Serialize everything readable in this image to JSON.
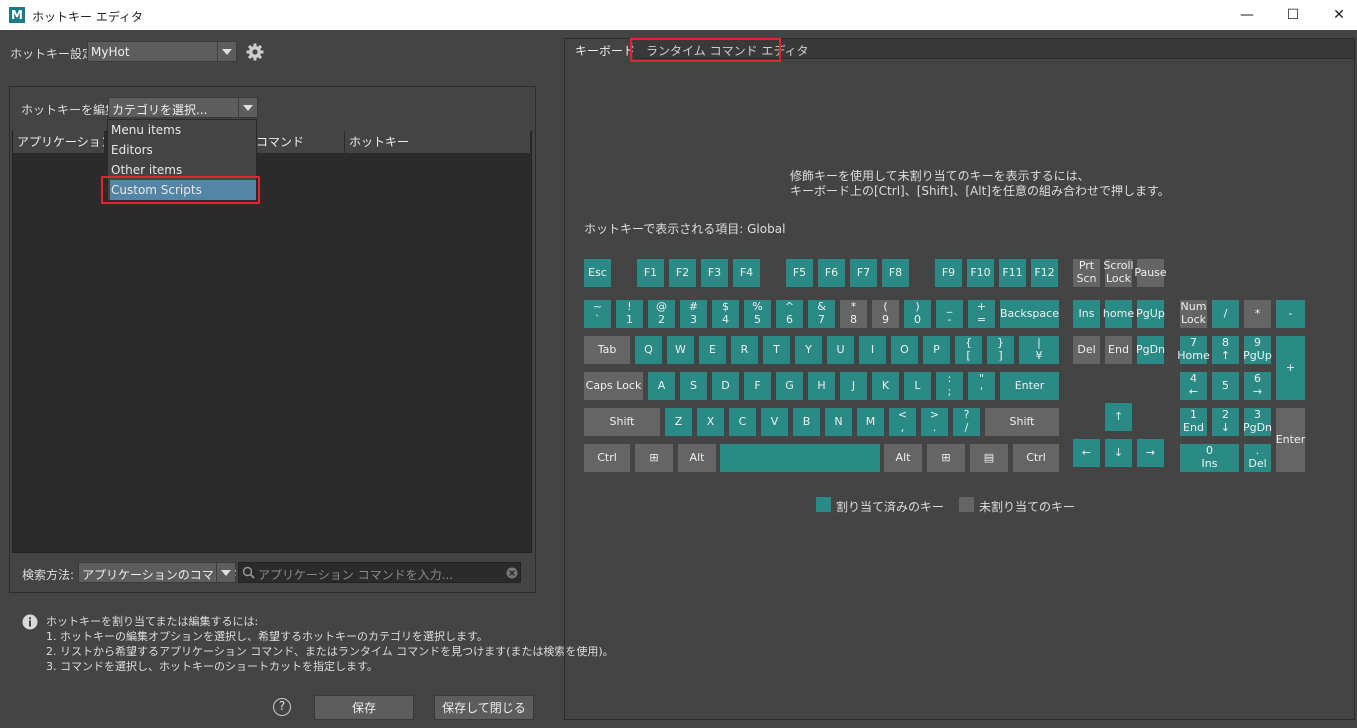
{
  "window": {
    "title": "ホットキー エディタ",
    "logo": "M",
    "minimize": "—",
    "maximize": "☐",
    "close": "✕"
  },
  "left": {
    "hotkey_setting_label": "ホットキー設定:",
    "hotkey_setting_value": "MyHot",
    "edit_label": "ホットキーを編集:",
    "edit_value": "カテゴリを選択...",
    "columns": [
      "アプリケーションのコ",
      "コマンド",
      "ホットキー"
    ],
    "dropdown": [
      "Menu items",
      "Editors",
      "Other items",
      "Custom Scripts"
    ],
    "search_method_label": "検索方法:",
    "search_method_value": "アプリケーションのコマンド",
    "search_placeholder": "アプリケーション コマンドを入力...",
    "help_lines": [
      "ホットキーを割り当てまたは編集するには:",
      "1. ホットキーの編集オプションを選択し、希望するホットキーのカテゴリを選択します。",
      "2. リストから希望するアプリケーション コマンド、またはランタイム コマンドを見つけます(または検索を使用)。",
      "3. コマンドを選択し、ホットキーのショートカットを指定します。"
    ],
    "help_button": "?",
    "save": "保存",
    "save_close": "保存して閉じる"
  },
  "right": {
    "tabs": [
      "キーボード",
      "ランタイム コマンド エディタ"
    ],
    "instruction": [
      "修飾キーを使用して未割り当てのキーを表示するには、",
      "キーボード上の[Ctrl]、[Shift]、[Alt]を任意の組み合わせで押します。"
    ],
    "display_label": "ホットキーで表示される項目: Global",
    "legend_assigned": "割り当て済みのキー",
    "legend_unassigned": "未割り当てのキー",
    "colors": {
      "assigned": "#2a8b86",
      "unassigned": "#656565"
    },
    "keys": {
      "esc": "Esc",
      "f1": "F1",
      "f2": "F2",
      "f3": "F3",
      "f4": "F4",
      "f5": "F5",
      "f6": "F6",
      "f7": "F7",
      "f8": "F8",
      "f9": "F9",
      "f10": "F10",
      "f11": "F11",
      "f12": "F12",
      "prtscn": "Prt\nScn",
      "scrolllock": "Scroll\nLock",
      "pause": "Pause",
      "tilde": "~\n`",
      "n1": "!\n1",
      "n2": "@\n2",
      "n3": "#\n3",
      "n4": "$\n4",
      "n5": "%\n5",
      "n6": "^\n6",
      "n7": "&\n7",
      "n8": "*\n8",
      "n9": "(\n9",
      "n0": ")\n0",
      "minus": "_\n-",
      "equal": "+\n=",
      "backspace": "Backspace",
      "ins": "Ins",
      "home": "home",
      "pgup": "PgUp",
      "numlock": "Num\nLock",
      "kpslash": "/",
      "kpstar": "*",
      "kpminus": "-",
      "tab": "Tab",
      "q": "Q",
      "w": "W",
      "e": "E",
      "r": "R",
      "t": "T",
      "y": "Y",
      "u": "U",
      "i": "I",
      "o": "O",
      "p": "P",
      "lbrace": "{\n[",
      "rbrace": "}\n]",
      "pipe": "|\n¥",
      "del": "Del",
      "end": "End",
      "pgdn": "PgDn",
      "kp7": "7\nHome",
      "kp8": "8\n↑",
      "kp9": "9\nPgUp",
      "kpplus": "+",
      "capslock": "Caps Lock",
      "a": "A",
      "s": "S",
      "d": "D",
      "f": "F",
      "g": "G",
      "h": "H",
      "j": "J",
      "k": "K",
      "l": "L",
      "semi": ":\n;",
      "quote": "\"\n'",
      "enter": "Enter",
      "kp4": "4\n←",
      "kp5": "5",
      "kp6": "6\n→",
      "lshift": "Shift",
      "z": "Z",
      "x": "X",
      "c": "C",
      "v": "V",
      "b": "B",
      "n": "N",
      "m": "M",
      "comma": "<\n,",
      "period": ">\n.",
      "slash": "?\n/",
      "rshift": "Shift",
      "up": "↑",
      "kp1": "1\nEnd",
      "kp2": "2\n↓",
      "kp3": "3\nPgDn",
      "kpenter": "Enter",
      "lctrl": "Ctrl",
      "lwin": "⊞",
      "lalt": "Alt",
      "space": "",
      "ralt": "Alt",
      "rwin": "⊞",
      "menu": "▤",
      "rctrl": "Ctrl",
      "left": "←",
      "down": "↓",
      "right": "→",
      "kp0": "0\nIns",
      "kpdot": ".\nDel"
    }
  }
}
